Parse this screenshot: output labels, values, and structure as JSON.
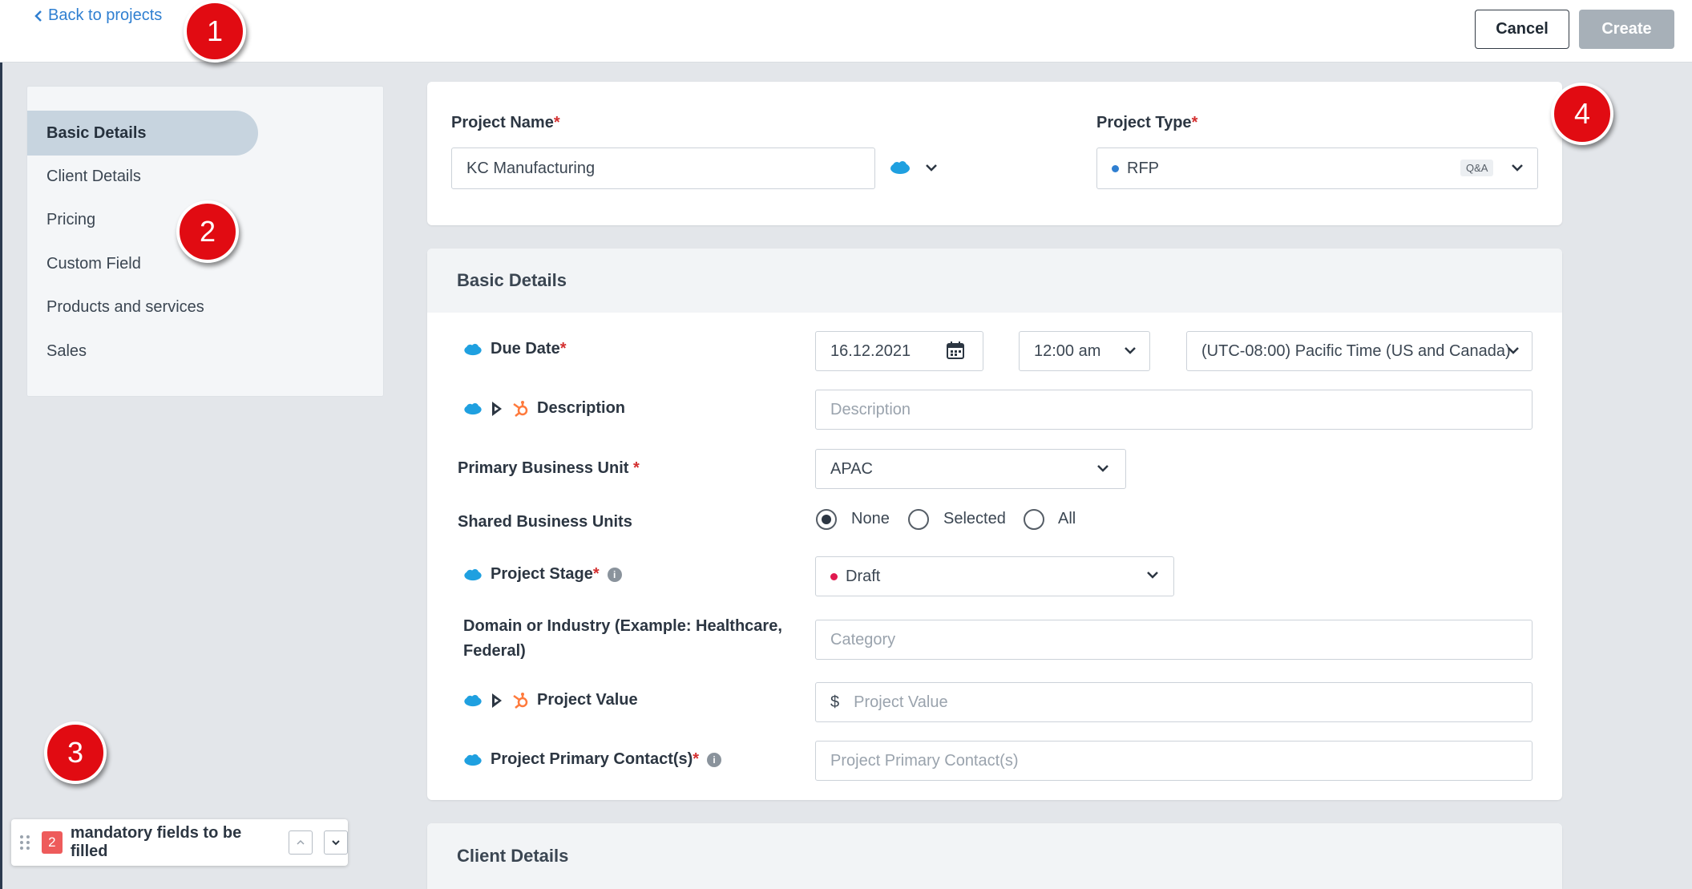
{
  "header": {
    "back_label": "Back to projects",
    "cancel_label": "Cancel",
    "create_label": "Create"
  },
  "callouts": [
    "1",
    "2",
    "3",
    "4"
  ],
  "sidebar": {
    "items": [
      {
        "label": "Basic Details",
        "active": true
      },
      {
        "label": "Client Details"
      },
      {
        "label": "Pricing"
      },
      {
        "label": "Custom Field"
      },
      {
        "label": "Products and services"
      },
      {
        "label": "Sales"
      }
    ]
  },
  "project": {
    "name_label": "Project Name",
    "name_value": "KC Manufacturing",
    "type_label": "Project Type",
    "type_value": "RFP",
    "type_tag": "Q&A"
  },
  "basic": {
    "section_title": "Basic Details",
    "due_date_label": "Due Date",
    "due_date_value": "16.12.2021",
    "due_time_value": "12:00 am",
    "timezone_value": "(UTC-08:00) Pacific Time (US and Canada)",
    "description_label": "Description",
    "description_placeholder": "Description",
    "primary_bu_label": "Primary Business Unit",
    "primary_bu_value": "APAC",
    "shared_bu_label": "Shared Business Units",
    "shared_options": [
      "None",
      "Selected",
      "All"
    ],
    "shared_selected": "None",
    "stage_label": "Project Stage",
    "stage_value": "Draft",
    "domain_label": "Domain or Industry (Example: Healthcare, Federal)",
    "domain_placeholder": "Category",
    "value_label": "Project Value",
    "value_currency": "$",
    "value_placeholder": "Project Value",
    "contact_label": "Project Primary Contact(s)",
    "contact_placeholder": "Project Primary Contact(s)"
  },
  "client": {
    "section_title": "Client Details"
  },
  "mandatory": {
    "count": "2",
    "text": "mandatory fields to be filled"
  },
  "colors": {
    "accent_link": "#2f7fd1",
    "required": "#d32f2f",
    "callout": "#e10b12",
    "salesforce": "#1fa0e0",
    "hubspot": "#ff7a3c",
    "type_dot": "#2f7fd1",
    "stage_dot": "#e0194f"
  },
  "icons": [
    "chevron-left-icon",
    "salesforce-cloud-icon",
    "dynamics-icon",
    "hubspot-icon",
    "calendar-icon",
    "chevron-down-icon",
    "chevron-up-icon",
    "info-icon",
    "drag-handle-icon"
  ]
}
